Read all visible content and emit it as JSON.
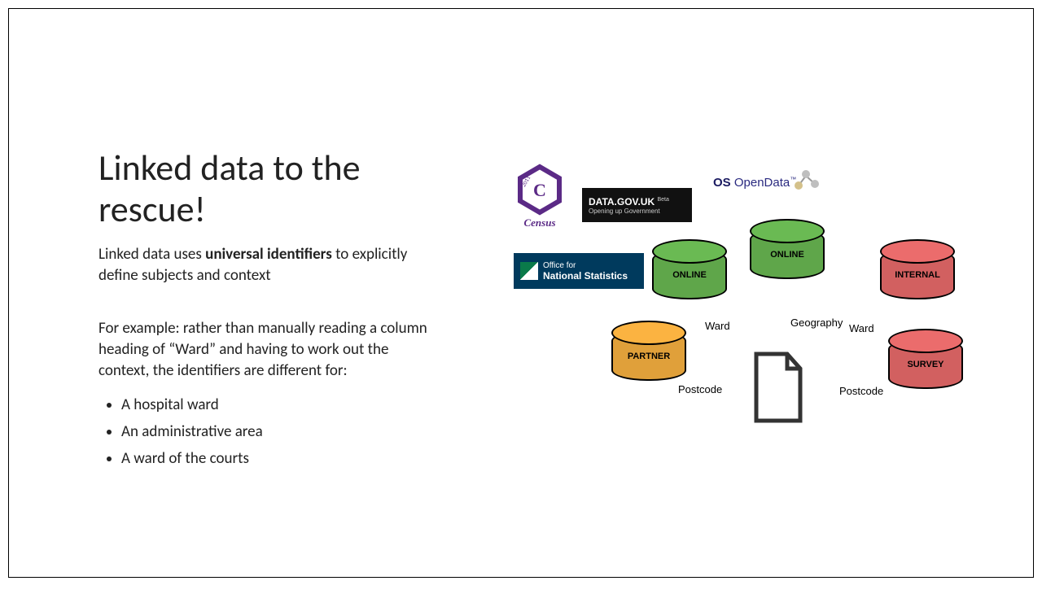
{
  "title": "Linked data to the rescue!",
  "subtitle_pre": "Linked data uses ",
  "subtitle_bold": "universal identifiers",
  "subtitle_post": " to explicitly define subjects and context",
  "paragraph": "For example: rather than manually reading a column heading of “Ward” and having to work out the context, the identifiers are different for:",
  "bullets": [
    "A hospital ward",
    "An administrative area",
    "A ward of the courts"
  ],
  "logos": {
    "census_year": "2011",
    "census_word": "Census",
    "datagov_main": "DATA.GOV.UK",
    "datagov_tag": "Beta",
    "datagov_sub": "Opening up Government",
    "ons_line1": "Office for",
    "ons_line2": "National Statistics",
    "os_pre": "OS",
    "os_main": " OpenData",
    "os_tm": "™"
  },
  "cylinders": {
    "online1": "ONLINE",
    "online2": "ONLINE",
    "internal": "INTERNAL",
    "partner": "PARTNER",
    "survey": "SURVEY"
  },
  "arrow_labels": {
    "ward1": "Ward",
    "geography": "Geography",
    "ward2": "Ward",
    "postcode1": "Postcode",
    "postcode2": "Postcode"
  }
}
